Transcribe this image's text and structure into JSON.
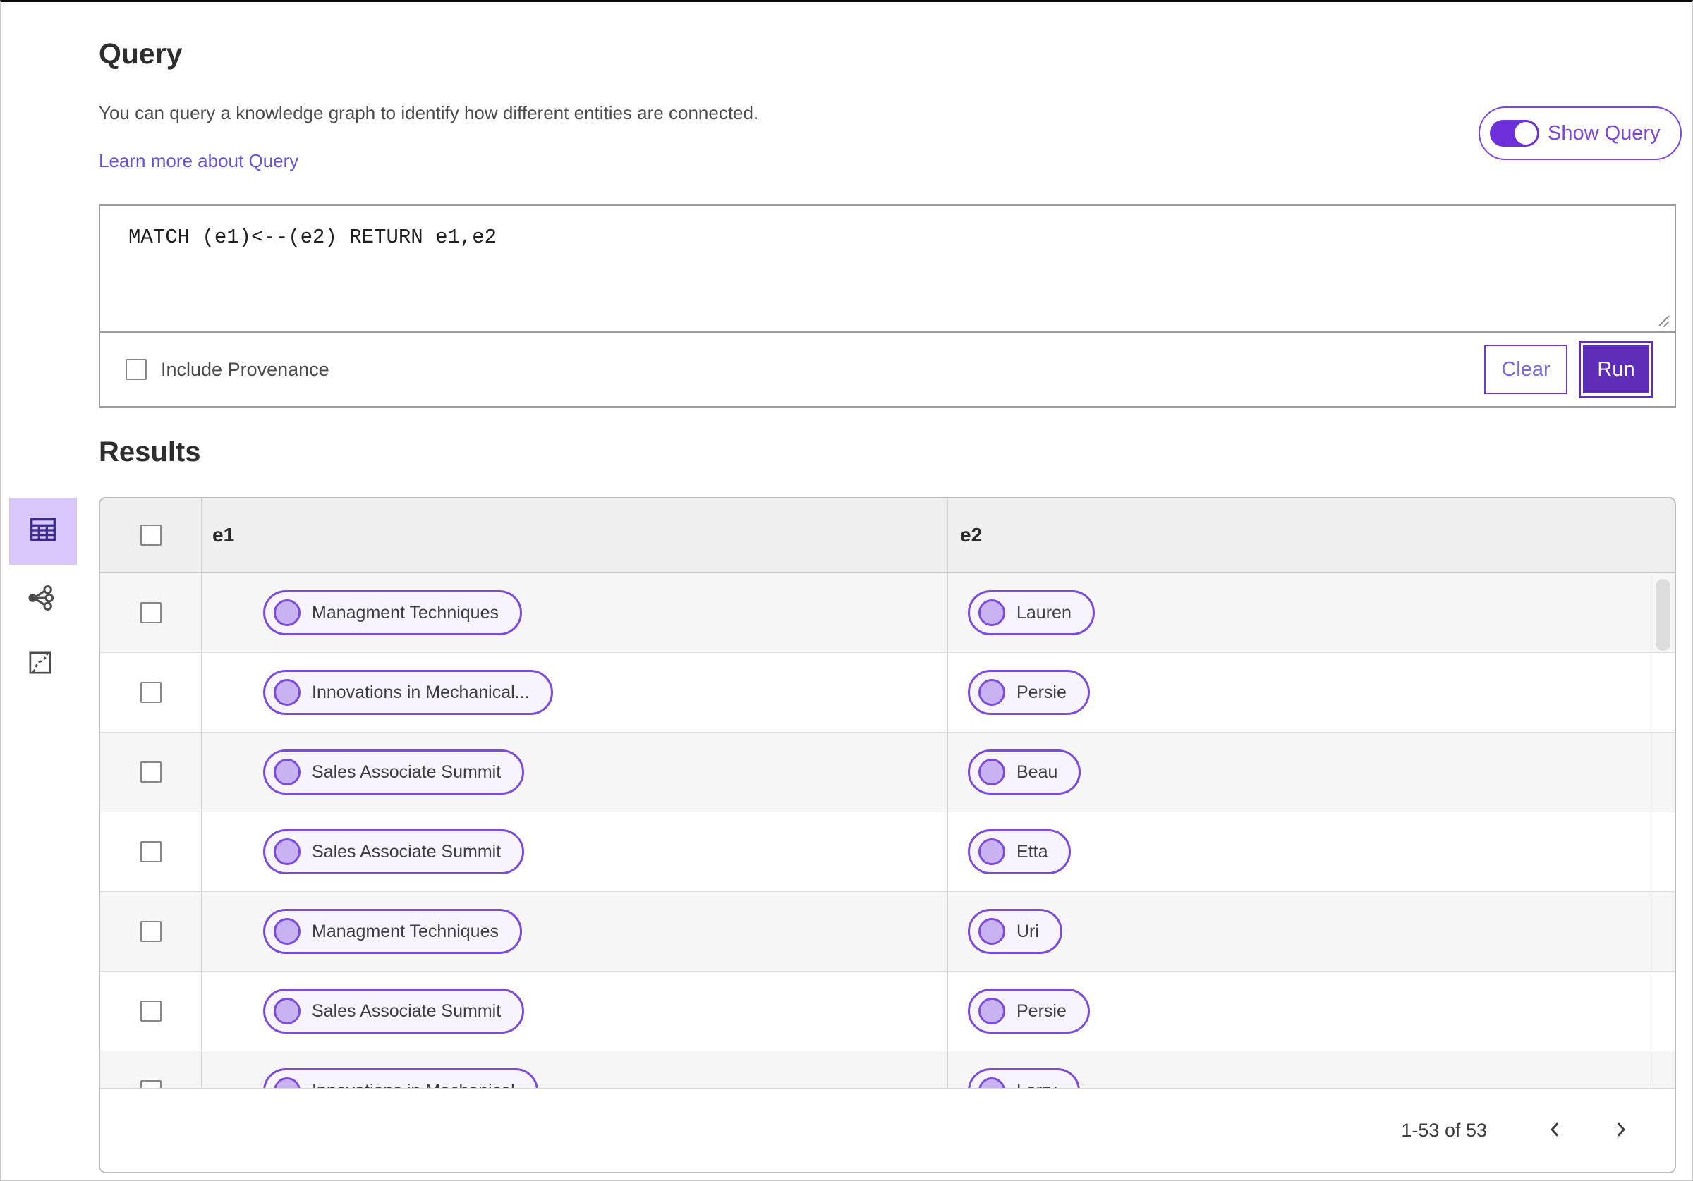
{
  "header": {
    "title": "Query",
    "description": "You can query a knowledge graph to identify how different entities are connected.",
    "learn_more": "Learn more about Query"
  },
  "query_panel": {
    "show_query_label": "Show Query",
    "show_query_on": true,
    "query_text": "MATCH (e1)<--(e2) RETURN e1,e2",
    "include_provenance_label": "Include Provenance",
    "include_provenance_checked": false,
    "clear_label": "Clear",
    "run_label": "Run"
  },
  "results": {
    "title": "Results",
    "columns": [
      "e1",
      "e2"
    ],
    "rows": [
      {
        "e1": "Managment Techniques",
        "e2": "Lauren"
      },
      {
        "e1": "Innovations in Mechanical...",
        "e2": "Persie"
      },
      {
        "e1": "Sales Associate Summit",
        "e2": "Beau"
      },
      {
        "e1": "Sales Associate Summit",
        "e2": "Etta"
      },
      {
        "e1": "Managment Techniques",
        "e2": "Uri"
      },
      {
        "e1": "Sales Associate Summit",
        "e2": "Persie"
      },
      {
        "e1": "Innovations in Mechanical",
        "e2": "Larry"
      }
    ],
    "pagination": {
      "label": "1-53 of 53"
    }
  },
  "view_switcher": {
    "selected": "table-view",
    "items": [
      "table-view",
      "graph-view",
      "map-view"
    ]
  },
  "colors": {
    "accent": "#7a45e0",
    "accent_dark": "#5e2eb8",
    "link": "#6553d6",
    "pill_border": "#7b4be0",
    "pill_bg": "#f7f4fe",
    "pill_dot": "#c9b2f1",
    "selected_tile_bg": "#d9c7fa",
    "table_header_bg": "#efefef",
    "row_alt_bg": "#f6f6f6"
  }
}
